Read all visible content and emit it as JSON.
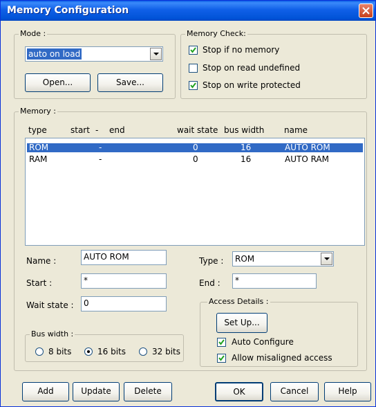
{
  "window": {
    "title": "Memory Configuration"
  },
  "mode": {
    "label": "Mode :",
    "selected": "auto on load",
    "open_label": "Open...",
    "save_label": "Save..."
  },
  "memory_check": {
    "label": "Memory Check:",
    "options": [
      {
        "label": "Stop if no memory",
        "checked": true
      },
      {
        "label": "Stop on read undefined",
        "checked": false
      },
      {
        "label": "Stop on write protected",
        "checked": true
      }
    ]
  },
  "memory": {
    "label": "Memory :",
    "columns": {
      "type": "type",
      "start": "start",
      "dash": "-",
      "end": "end",
      "wait": "wait state",
      "bus": "bus width",
      "name": "name"
    },
    "rows": [
      {
        "type": "ROM",
        "start": "-",
        "wait": "0",
        "bus": "16",
        "name": "AUTO ROM",
        "selected": true
      },
      {
        "type": "RAM",
        "start": "-",
        "wait": "0",
        "bus": "16",
        "name": "AUTO RAM",
        "selected": false
      }
    ]
  },
  "fields": {
    "name_label": "Name :",
    "name_value": "AUTO ROM",
    "start_label": "Start :",
    "start_value": "*",
    "wait_label": "Wait state :",
    "wait_value": "0",
    "type_label": "Type :",
    "type_value": "ROM",
    "end_label": "End :",
    "end_value": "*"
  },
  "bus_width": {
    "label": "Bus width :",
    "options": [
      {
        "label": "8 bits",
        "selected": false
      },
      {
        "label": "16 bits",
        "selected": true
      },
      {
        "label": "32 bits",
        "selected": false
      }
    ]
  },
  "access": {
    "label": "Access Details :",
    "setup_label": "Set Up...",
    "auto_configure": "Auto Configure",
    "allow_misaligned": "Allow misaligned access"
  },
  "buttons": {
    "add": "Add",
    "update": "Update",
    "delete": "Delete",
    "ok": "OK",
    "cancel": "Cancel",
    "help": "Help"
  },
  "colors": {
    "title_bar": "#0a5ce6",
    "selection": "#316ac5",
    "dialog_bg": "#ece9d8"
  }
}
